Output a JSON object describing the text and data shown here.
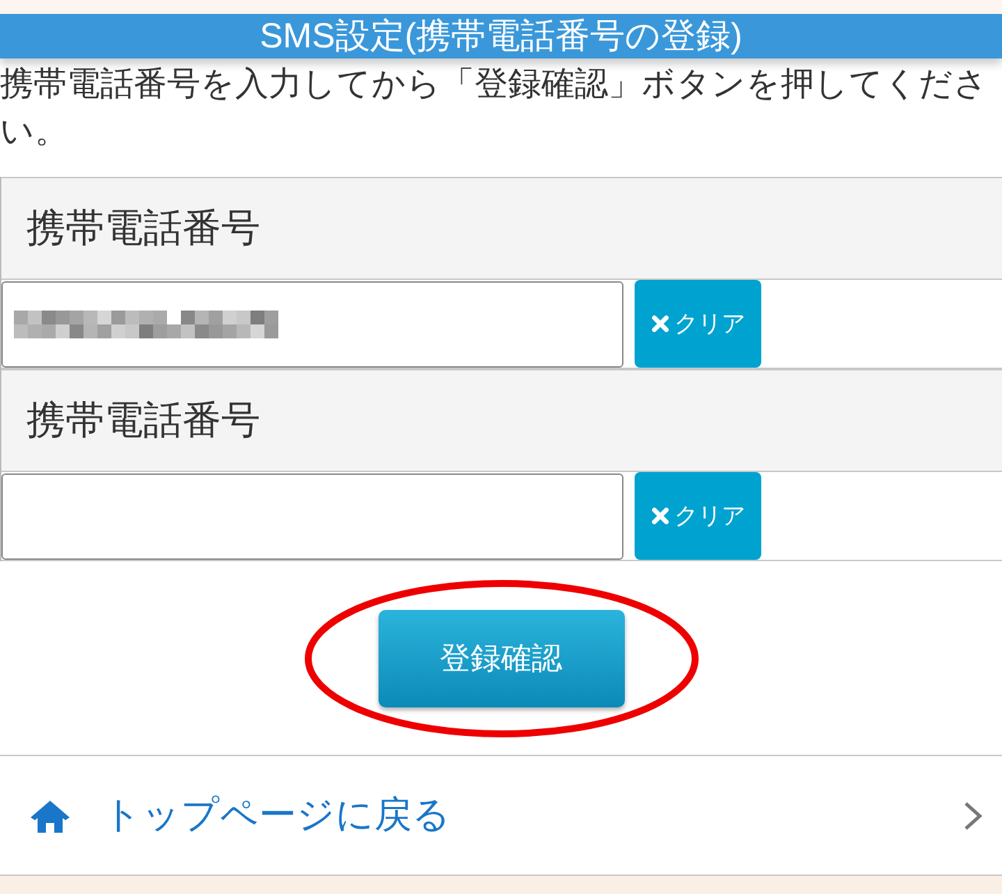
{
  "header": {
    "title": "SMS設定(携帯電話番号の登録)"
  },
  "instruction": "携帯電話番号を入力してから「登録確認」ボタンを押してください。",
  "fields": [
    {
      "label": "携帯電話番号",
      "value_redacted": true,
      "clear_button": "クリア"
    },
    {
      "label": "携帯電話番号",
      "value_redacted": false,
      "clear_button": "クリア"
    }
  ],
  "submit_button": {
    "label": "登録確認",
    "highlighted": true
  },
  "nav_link": {
    "label": "トップページに戻る"
  }
}
